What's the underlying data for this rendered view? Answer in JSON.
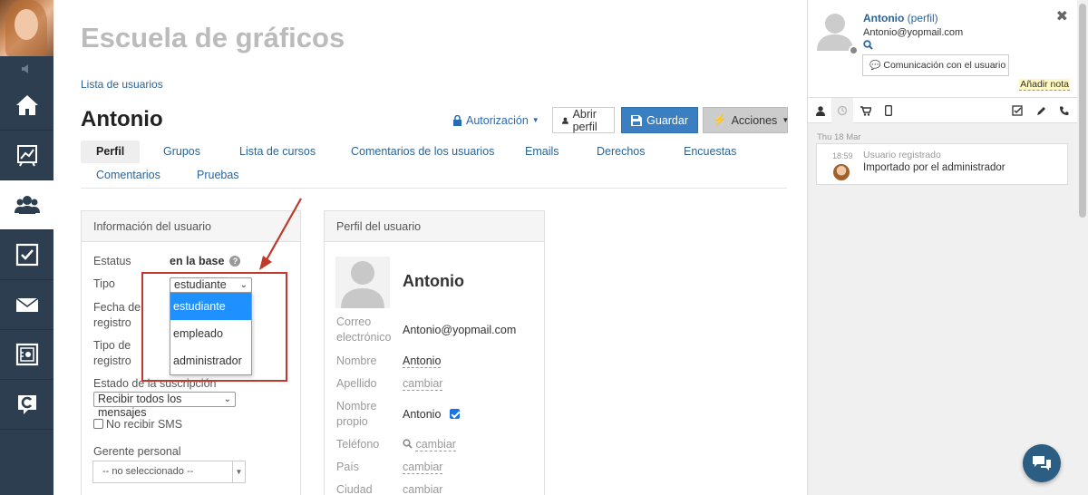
{
  "sidebar": {
    "items": [
      {
        "icon": "home-icon"
      },
      {
        "icon": "chart-icon"
      },
      {
        "icon": "users-icon",
        "active": true
      },
      {
        "icon": "checkbox-icon"
      },
      {
        "icon": "mail-icon"
      },
      {
        "icon": "safe-icon"
      },
      {
        "icon": "chat-logo-icon"
      }
    ]
  },
  "header": {
    "school_title": "Escuela de gráficos",
    "breadcrumb": "Lista de usuarios",
    "user_name": "Antonio"
  },
  "actions": {
    "authorization": "Autorización",
    "open_profile": "Abrir perfil",
    "save": "Guardar",
    "actions": "Acciones"
  },
  "tabs": {
    "row1": [
      "Perfil",
      "Grupos",
      "Lista de cursos",
      "Comentarios de los usuarios",
      "Emails",
      "Derechos",
      "Encuestas"
    ],
    "row2": [
      "Comentarios",
      "Pruebas"
    ],
    "active": "Perfil"
  },
  "info_panel": {
    "title": "Información del usuario",
    "status_label": "Estatus",
    "status_value": "en la base",
    "type_label": "Tipo",
    "type_value": "estudiante",
    "type_options": [
      "estudiante",
      "empleado",
      "administrador"
    ],
    "reg_date_label_1": "Fecha de",
    "reg_date_label_2": "registro",
    "reg_type_label_1": "Tipo de",
    "reg_type_label_2": "registro",
    "subscription_label": "Estado de la suscripción",
    "subscription_value": "Recibir todos los mensajes",
    "no_sms_label": "No recibir SMS",
    "manager_label": "Gerente personal",
    "manager_value": "-- no seleccionado --"
  },
  "profile_panel": {
    "title": "Perfil del usuario",
    "name": "Antonio",
    "email_label_1": "Correo",
    "email_label_2": "electrónico",
    "email_value": "Antonio@yopmail.com",
    "first_name_label": "Nombre",
    "first_name_value": "Antonio",
    "last_name_label": "Apellido",
    "last_name_value": "cambiar",
    "own_name_label_1": "Nombre",
    "own_name_label_2": "propio",
    "own_name_value": "Antonio",
    "phone_label": "Teléfono",
    "phone_value": "cambiar",
    "country_label": "País",
    "country_value": "cambiar",
    "city_label": "Ciudad",
    "city_value": "cambiar"
  },
  "right_panel": {
    "name": "Antonio",
    "profile_link": "(perfil)",
    "email": "Antonio@yopmail.com",
    "communication_button": "Comunicación con el usuario",
    "add_note": "Añadir nota",
    "date": "Thu 18 Mar",
    "entry_time": "18:59",
    "entry_title": "Usuario registrado",
    "entry_text": "Importado por el administrador"
  },
  "colors": {
    "sidebar_bg": "#2c3e50",
    "link": "#2a6496",
    "primary": "#3a7fc1",
    "highlight": "#c0392b",
    "dropdown_selected": "#1e90ff"
  }
}
